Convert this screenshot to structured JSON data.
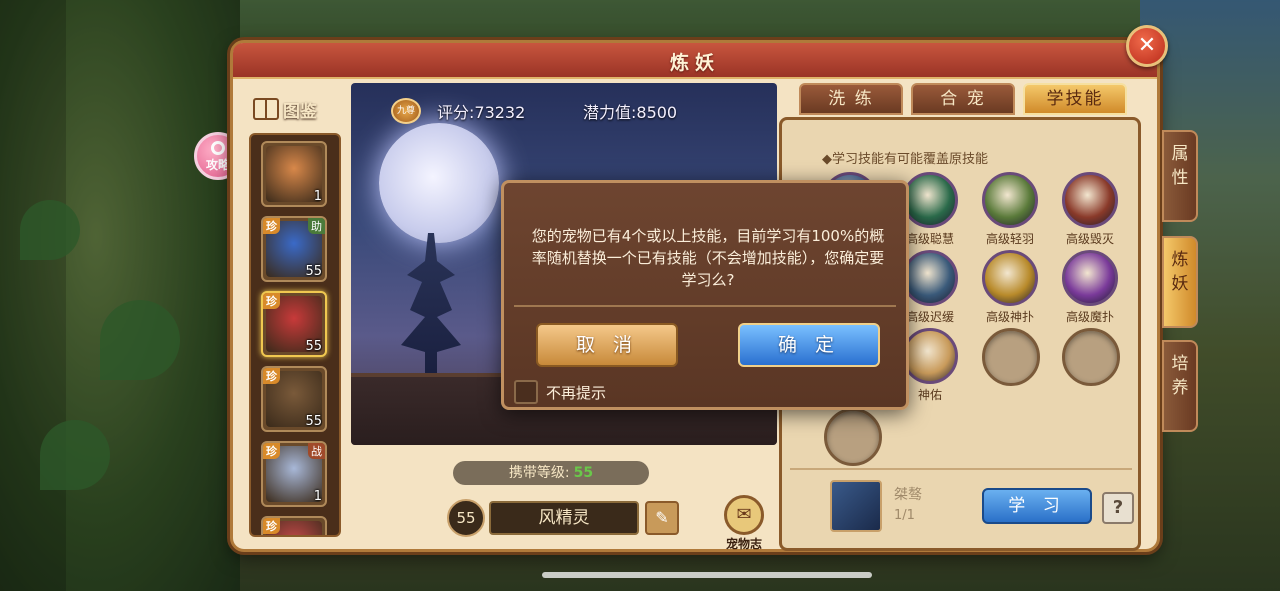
{
  "window": {
    "title": "炼妖",
    "close_label": "✕"
  },
  "guide": {
    "label": "攻略"
  },
  "atlas": {
    "label": "图鉴"
  },
  "pets": [
    {
      "level": "1",
      "rare": "",
      "role": "",
      "art": "#d8884a"
    },
    {
      "level": "55",
      "rare": "珍",
      "role": "助",
      "art": "#3a6ac8"
    },
    {
      "level": "55",
      "rare": "珍",
      "role": "",
      "art": "#c83a3a",
      "selected": true
    },
    {
      "level": "55",
      "rare": "珍",
      "role": "",
      "art": "#7a5a3a"
    },
    {
      "level": "1",
      "rare": "珍",
      "role": "战",
      "art": "#a8b8d8"
    },
    {
      "level": "",
      "rare": "珍",
      "role": "",
      "art": "#c84a4a"
    }
  ],
  "stats": {
    "nine_label": "九尊",
    "score": "评分:73232",
    "potential": "潜力值:8500"
  },
  "carry": {
    "label": "携带等级:",
    "value": "55"
  },
  "pet": {
    "level": "55",
    "name": "风精灵",
    "rename_icon": "✎"
  },
  "pet_log": {
    "label": "宠物志"
  },
  "tabs": [
    {
      "label": "洗 练"
    },
    {
      "label": "合 宠"
    },
    {
      "label": "学技能",
      "active": true
    }
  ],
  "side_tabs": [
    {
      "label": "属\n性"
    },
    {
      "label": "炼\n妖",
      "active": true
    },
    {
      "label": "培\n养"
    }
  ],
  "skills": {
    "notice": "◆学习技能有可能覆盖原技能",
    "items": [
      {
        "label": "",
        "color": "#4a6a9a"
      },
      {
        "label": "高级聪慧",
        "color": "#2a6a4a"
      },
      {
        "label": "高级轻羽",
        "color": "#5a7a3a"
      },
      {
        "label": "高级毁灭",
        "color": "#8a3a2a"
      },
      {
        "label": "高级迟缓",
        "color": "#3a5a7a"
      },
      {
        "label": "高级神扑",
        "color": "#b88a2a"
      },
      {
        "label": "高级魔扑",
        "color": "#7a3a9a"
      },
      {
        "label": "神佑",
        "color": "#c89a5a"
      }
    ]
  },
  "learn": {
    "book_name": "桀骜",
    "book_count": "1/1",
    "button": "学 习",
    "help": "?"
  },
  "dialog": {
    "message": "您的宠物已有4个或以上技能，目前学习有100%的概率随机替换一个已有技能（不会增加技能），您确定要学习么?",
    "cancel": "取 消",
    "confirm": "确 定",
    "dont_remind": "不再提示"
  }
}
